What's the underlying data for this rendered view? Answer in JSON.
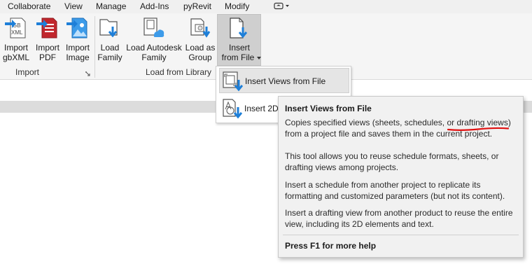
{
  "menu": {
    "items": [
      "Collaborate",
      "View",
      "Manage",
      "Add-Ins",
      "pyRevit",
      "Modify"
    ],
    "qat_icon": "dropdown-toggle-icon"
  },
  "ribbon": {
    "import_panel": {
      "title": "Import",
      "tools": [
        {
          "line1": "Import",
          "line2": "gbXML",
          "icon": "gbxml-import-icon"
        },
        {
          "line1": "Import",
          "line2": "PDF",
          "icon": "pdf-import-icon"
        },
        {
          "line1": "Import",
          "line2": "Image",
          "icon": "image-import-icon"
        }
      ],
      "icon_text": {
        "gb": "GB",
        "xml": "XML"
      }
    },
    "library_panel": {
      "title": "Load from Library",
      "tools": [
        {
          "line1": "Load",
          "line2": "Family",
          "icon": "load-family-icon"
        },
        {
          "line1": "Load Autodesk",
          "line2": "Family",
          "icon": "autodesk-family-icon"
        },
        {
          "line1": "Load as",
          "line2": "Group",
          "icon": "load-group-icon"
        },
        {
          "line1": "Insert",
          "line2": "from File",
          "icon": "insert-from-file-icon"
        }
      ]
    }
  },
  "dropdown": {
    "items": [
      {
        "label": "Insert Views from File",
        "icon": "insert-views-icon"
      },
      {
        "label": "Insert 2D",
        "icon": "insert-2d-icon"
      }
    ]
  },
  "tooltip": {
    "title": "Insert Views from File",
    "p1_line1": "Copies specified views (sheets, schedules, or drafting views)",
    "p1_line2": "from a project file and saves them in the current project.",
    "p2_line1": "This tool allows you to reuse schedule formats, sheets, or",
    "p2_line2": "drafting views among projects.",
    "p3_line1": "Insert a schedule from another project to replicate its",
    "p3_line2": "formatting and customized parameters (but not its content).",
    "p4_line1": "Insert a drafting view from another product to reuse the entire",
    "p4_line2": "view, including its 2D elements and text.",
    "help": "Press F1 for more help"
  },
  "colors": {
    "accent_blue": "#1e7fd8",
    "pdf_red": "#c1272d",
    "annotation_red": "#e01010"
  }
}
